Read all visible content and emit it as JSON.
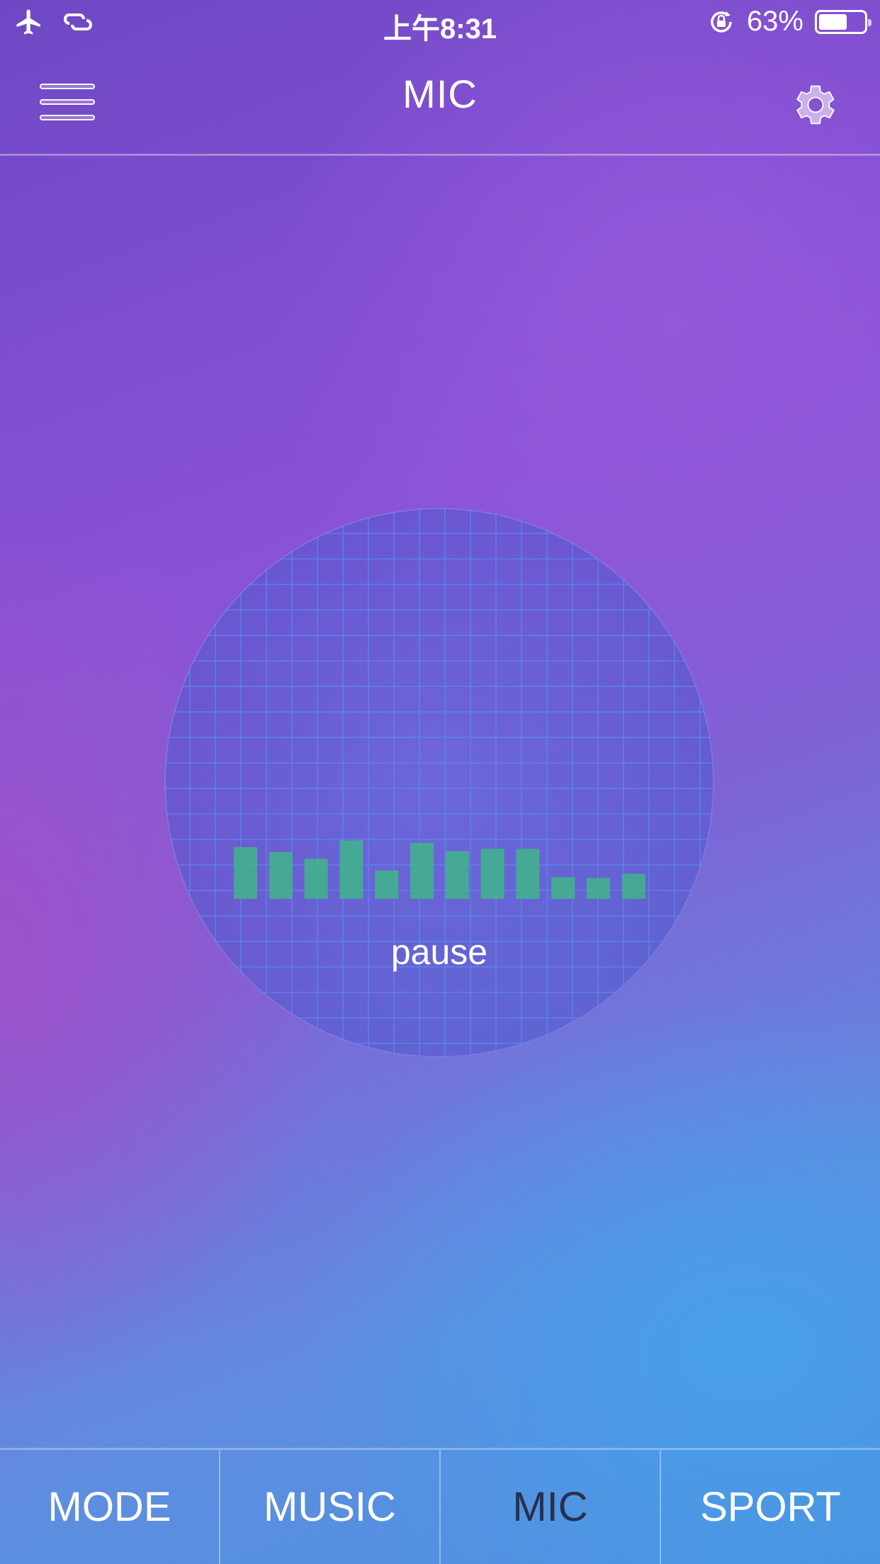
{
  "status_bar": {
    "time": "上午8:31",
    "battery_percent": "63%",
    "battery_level": 0.63,
    "icons": [
      "airplane-icon",
      "link-icon",
      "rotation-lock-icon",
      "battery-icon"
    ]
  },
  "nav_bar": {
    "title": "MIC",
    "left_icon": "hamburger-menu-icon",
    "right_icon": "gear-icon"
  },
  "visualizer": {
    "state_label": "pause",
    "bar_color": "#3fb58a",
    "levels": [
      0.62,
      0.56,
      0.48,
      0.7,
      0.34,
      0.67,
      0.57,
      0.6,
      0.6,
      0.26,
      0.25,
      0.3
    ]
  },
  "tabs": [
    {
      "label": "MODE",
      "active": false
    },
    {
      "label": "MUSIC",
      "active": false
    },
    {
      "label": "MIC",
      "active": true
    },
    {
      "label": "SPORT",
      "active": false
    }
  ],
  "colors": {
    "active_tab_text": "#2a2f4a",
    "text": "#ffffff"
  }
}
